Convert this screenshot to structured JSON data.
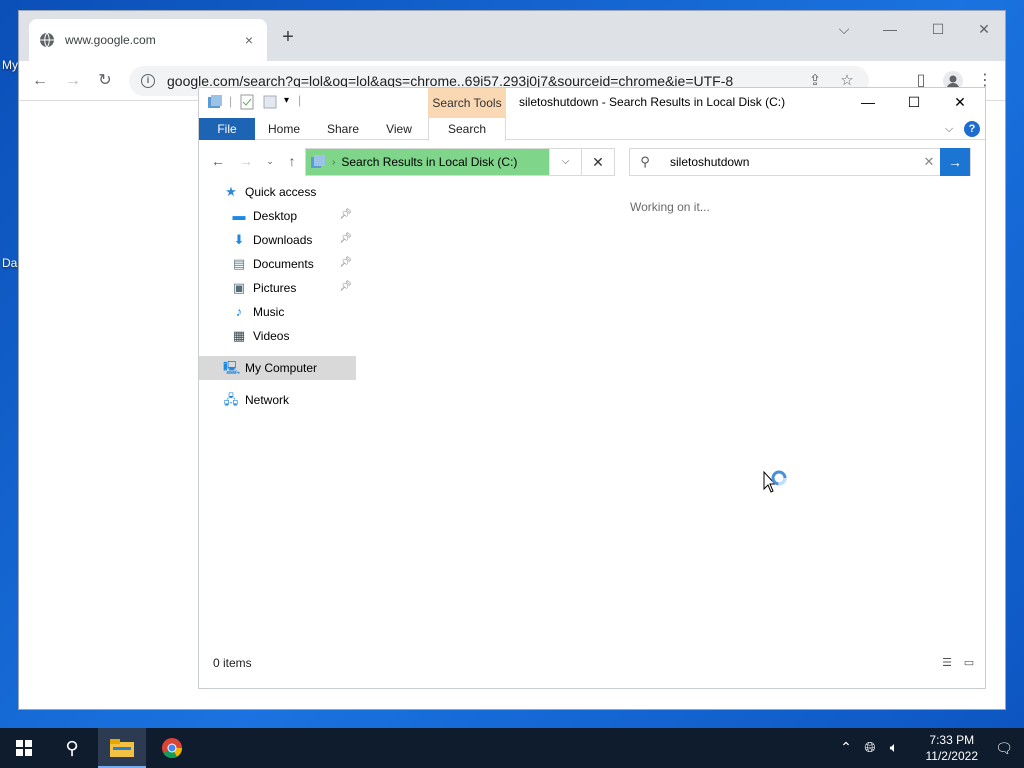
{
  "desktop": {
    "labels": [
      "My",
      "Da"
    ]
  },
  "chrome": {
    "tab_title": "www.google.com",
    "tab_close": "×",
    "new_tab": "+",
    "url": "google.com/search?q=lol&oq=lol&aqs=chrome..69i57.293j0j7&sourceid=chrome&ie=UTF-8",
    "icons": {
      "back": "arrow-left-icon",
      "forward": "arrow-right-icon",
      "reload": "reload-icon",
      "info": "info-icon",
      "share": "share-icon",
      "bookmark": "star-icon",
      "side_panel": "side-panel-icon",
      "profile": "profile-icon",
      "menu": "kebab-menu-icon"
    }
  },
  "explorer": {
    "context_tab": "Search Tools",
    "title": "siletoshutdown - Search Results in Local Disk (C:)",
    "ribbon_tabs": [
      "File",
      "Home",
      "Share",
      "View",
      "Search"
    ],
    "address": "Search Results in Local Disk (C:)",
    "search_query": "siletoshutdown",
    "working_text": "Working on it...",
    "nav": {
      "quick_access": "Quick access",
      "items": [
        {
          "label": "Desktop",
          "pinned": true
        },
        {
          "label": "Downloads",
          "pinned": true
        },
        {
          "label": "Documents",
          "pinned": true
        },
        {
          "label": "Pictures",
          "pinned": true
        },
        {
          "label": "Music",
          "pinned": false
        },
        {
          "label": "Videos",
          "pinned": false
        }
      ],
      "computer": "My Computer",
      "network": "Network"
    },
    "status": "0 items",
    "colors": {
      "context_tab": "#f9d8b3",
      "file_tab": "#1e64b4",
      "address_fill": "#7fd68a",
      "go_button": "#1a76d2"
    }
  },
  "taskbar": {
    "time": "7:33 PM",
    "date": "11/2/2022"
  }
}
